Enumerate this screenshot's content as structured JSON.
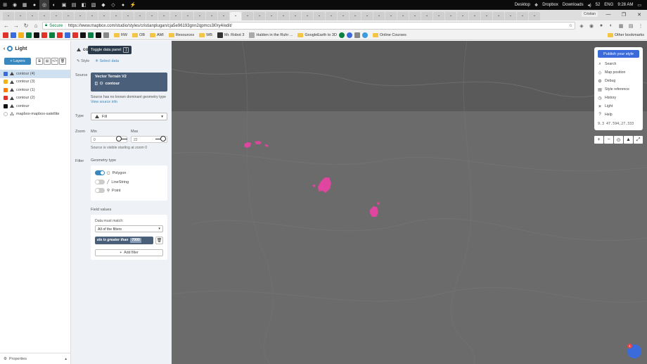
{
  "taskbar": {
    "tray_items": [
      "Desktop",
      "Dropbox",
      "Downloads"
    ],
    "volume": "52",
    "language": "ENG",
    "time": "9:28 AM"
  },
  "browser": {
    "profile": "Cristian",
    "secure_label": "Secure",
    "url": "https://www.mapbox.com/studio/styles/cristianplugan/cja5e96193gnn2qpmcs3l0ry4/edit/",
    "bookmarks": [
      "RW",
      "OB",
      "AMI",
      "Resources",
      "WB",
      "Mr. Robot 3",
      "Halden in the Ruhr ...",
      "GoogleEarth to 3D",
      "Online Courses"
    ],
    "other_bookmarks": "Other bookmarks"
  },
  "layers_panel": {
    "style_name": "Light",
    "layers_button": "Layers",
    "layers": [
      {
        "name": "contour (4)",
        "color": "#3b6bdb"
      },
      {
        "name": "contour (3)",
        "color": "#f2b21b"
      },
      {
        "name": "contour (1)",
        "color": "#ff7b00"
      },
      {
        "name": "contour (2)",
        "color": "#e0312b"
      },
      {
        "name": "contour",
        "color": "#111111"
      },
      {
        "name": "mapbox-mapbox-satellite",
        "color": "#cccccc"
      }
    ],
    "footer": "Properties"
  },
  "editor": {
    "title": "co",
    "tooltip": "Toggle data panel",
    "tooltip_key": "]",
    "tabs": [
      "Style",
      "Select data"
    ],
    "source_label": "Source",
    "source_name": "Vector Terrain V2",
    "source_layer": "contour",
    "source_note": "Source has no known dominant geometry type",
    "view_source": "View source info",
    "type_label": "Type",
    "type_value": "Fill",
    "zoom_label": "Zoom",
    "zoom_min_label": "Min",
    "zoom_max_label": "Max",
    "zoom_min": "0",
    "zoom_max": "22",
    "zoom_note": "Source is visible starting at zoom 0",
    "filter_label": "Filter",
    "geometry_label": "Geometry type",
    "geometry_types": [
      {
        "label": "Polygon",
        "enabled": true
      },
      {
        "label": "LineString",
        "enabled": false
      },
      {
        "label": "Point",
        "enabled": false
      }
    ],
    "field_values_label": "Field values",
    "match_label": "Data must match:",
    "match_value": "All of the filters",
    "filter_expression": "ele is greater than",
    "filter_value": "7000",
    "add_filter": "Add filter"
  },
  "map_menu": {
    "publish": "Publish your style",
    "items": [
      {
        "label": "Search",
        "icon": "search-icon"
      },
      {
        "label": "Map position",
        "icon": "position-icon"
      },
      {
        "label": "Debug",
        "icon": "debug-icon"
      },
      {
        "label": "Style reference",
        "icon": "book-icon"
      },
      {
        "label": "History",
        "icon": "history-icon"
      },
      {
        "label": "Light",
        "icon": "light-icon"
      },
      {
        "label": "Help",
        "icon": "help-icon"
      }
    ],
    "coords": "9.3  47.594,27.333"
  },
  "help_badge": "1",
  "colors": {
    "accent": "#3887be",
    "highlight": "#e0459f",
    "publish": "#3b6bdb"
  }
}
